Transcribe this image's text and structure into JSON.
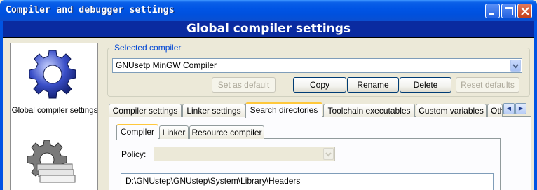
{
  "window": {
    "title": "Compiler and debugger settings",
    "controls": [
      "minimize-icon",
      "maximize-icon",
      "close-icon"
    ]
  },
  "header": {
    "title": "Global compiler settings"
  },
  "sidebar": {
    "items": [
      {
        "label": "Global compiler settings",
        "icon": "gear-icon"
      },
      {
        "label": "",
        "icon": "gear-with-papers-icon"
      }
    ]
  },
  "selected_compiler": {
    "legend": "Selected compiler",
    "value": "GNUsetp MinGW Compiler",
    "buttons": {
      "set_default": "Set as default",
      "copy": "Copy",
      "rename": "Rename",
      "delete": "Delete",
      "reset_defaults": "Reset defaults"
    }
  },
  "tabs": [
    "Compiler settings",
    "Linker settings",
    "Search directories",
    "Toolchain executables",
    "Custom variables",
    "Oth"
  ],
  "active_tab": "Search directories",
  "subtabs": [
    "Compiler",
    "Linker",
    "Resource compiler"
  ],
  "active_subtab": "Compiler",
  "policy": {
    "label": "Policy:",
    "value": ""
  },
  "directories": [
    "D:\\GNUstep\\GNUstep\\System\\Library\\Headers"
  ],
  "colors": {
    "title_bar": "#0054e3",
    "header_band": "#0a2ba0",
    "accent_tab": "#ffc83c",
    "group_legend": "#0046d5"
  }
}
